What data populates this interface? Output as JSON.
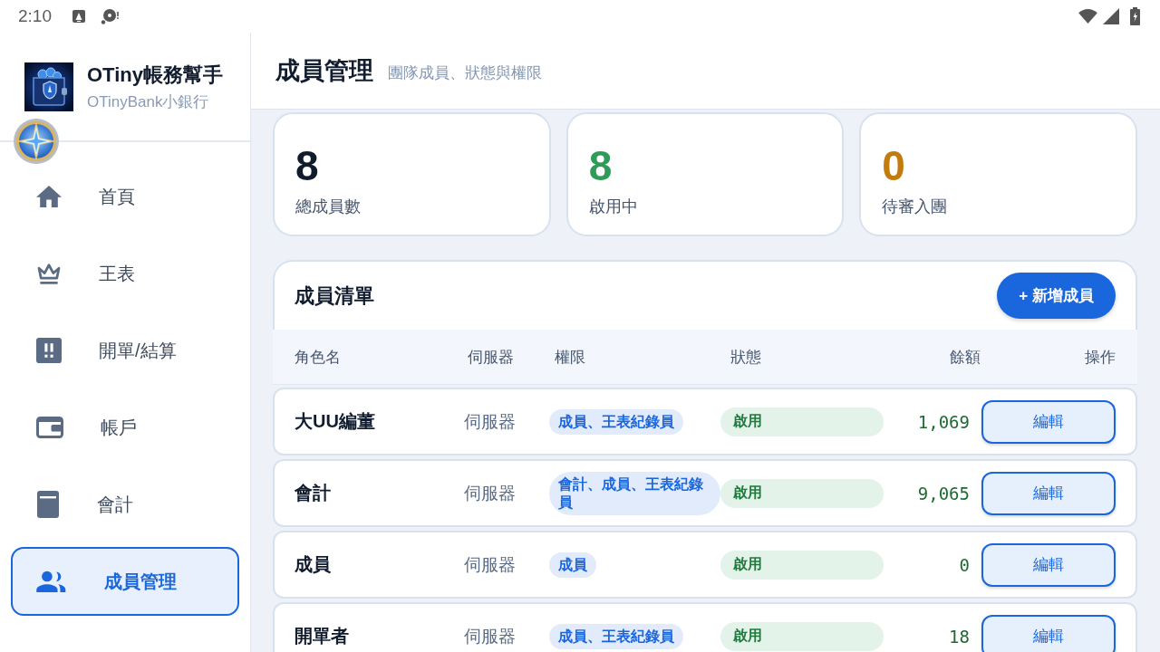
{
  "status_bar": {
    "time": "2:10"
  },
  "sidebar": {
    "app_title": "OTiny帳務幫手",
    "app_subtitle": "OTinyBank小銀行",
    "items": [
      {
        "label": "首頁",
        "selected": false
      },
      {
        "label": "王表",
        "selected": false
      },
      {
        "label": "開單/結算",
        "selected": false
      },
      {
        "label": "帳戶",
        "selected": false
      },
      {
        "label": "會計",
        "selected": false
      },
      {
        "label": "成員管理",
        "selected": true
      }
    ]
  },
  "header": {
    "title": "成員管理",
    "subtitle": "團隊成員、狀態與權限"
  },
  "stats": [
    {
      "value": "8",
      "label": "總成員數",
      "color": "#101b2c"
    },
    {
      "value": "8",
      "label": "啟用中",
      "color": "#2e9b58"
    },
    {
      "value": "0",
      "label": "待審入團",
      "color": "#c27c0e"
    }
  ],
  "member_list": {
    "title": "成員清單",
    "add_button": "+ 新增成員",
    "columns": [
      "角色名",
      "伺服器",
      "權限",
      "狀態",
      "餘額",
      "操作"
    ],
    "rows": [
      {
        "name": "大UU編董",
        "server": "伺服器",
        "roles": "成員、王表紀錄員",
        "status": "啟用",
        "balance": "1,069",
        "action": "編輯"
      },
      {
        "name": "會計",
        "server": "伺服器",
        "roles": "會計、成員、王表紀錄員",
        "status": "啟用",
        "balance": "9,065",
        "action": "編輯"
      },
      {
        "name": "成員",
        "server": "伺服器",
        "roles": "成員",
        "status": "啟用",
        "balance": "0",
        "action": "編輯"
      },
      {
        "name": "開單者",
        "server": "伺服器",
        "roles": "成員、王表紀錄員",
        "status": "啟用",
        "balance": "18",
        "action": "編輯"
      }
    ]
  }
}
